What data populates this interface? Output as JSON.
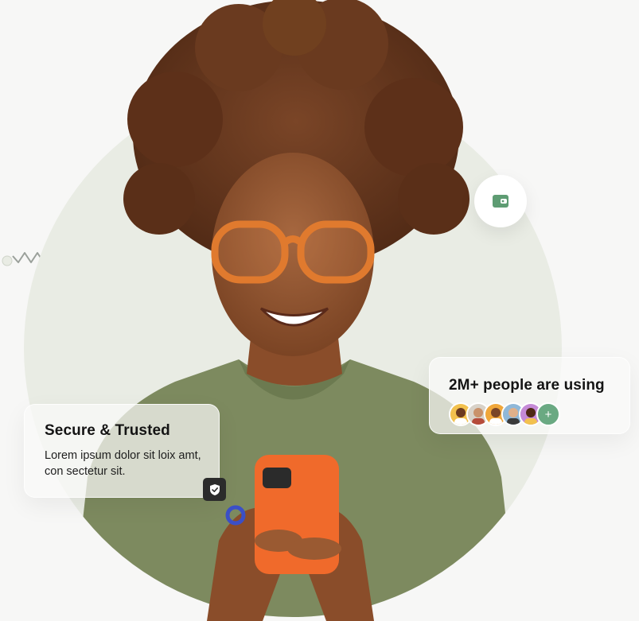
{
  "secure_card": {
    "title": "Secure & Trusted",
    "description": "Lorem ipsum dolor sit loix amt, con sectetur sit.",
    "icon": "shield-check-icon"
  },
  "users_card": {
    "title": "2M+ people are using",
    "avatars": [
      {
        "name": "avatar-1",
        "color": "#f2c14e"
      },
      {
        "name": "avatar-2",
        "color": "#d8d2c8"
      },
      {
        "name": "avatar-3",
        "color": "#f0a73a"
      },
      {
        "name": "avatar-4",
        "color": "#8fb8d8"
      },
      {
        "name": "avatar-5",
        "color": "#c58ad6"
      }
    ],
    "more_label": "+"
  },
  "wallet_badge": {
    "icon": "wallet-icon"
  },
  "colors": {
    "accent_green": "#5e9c73",
    "circle_bg": "#e9ece4",
    "sweater": "#7d8a5f",
    "phone": "#f06a2b",
    "hair": "#6b3a1f",
    "glasses": "#e07a2e"
  }
}
